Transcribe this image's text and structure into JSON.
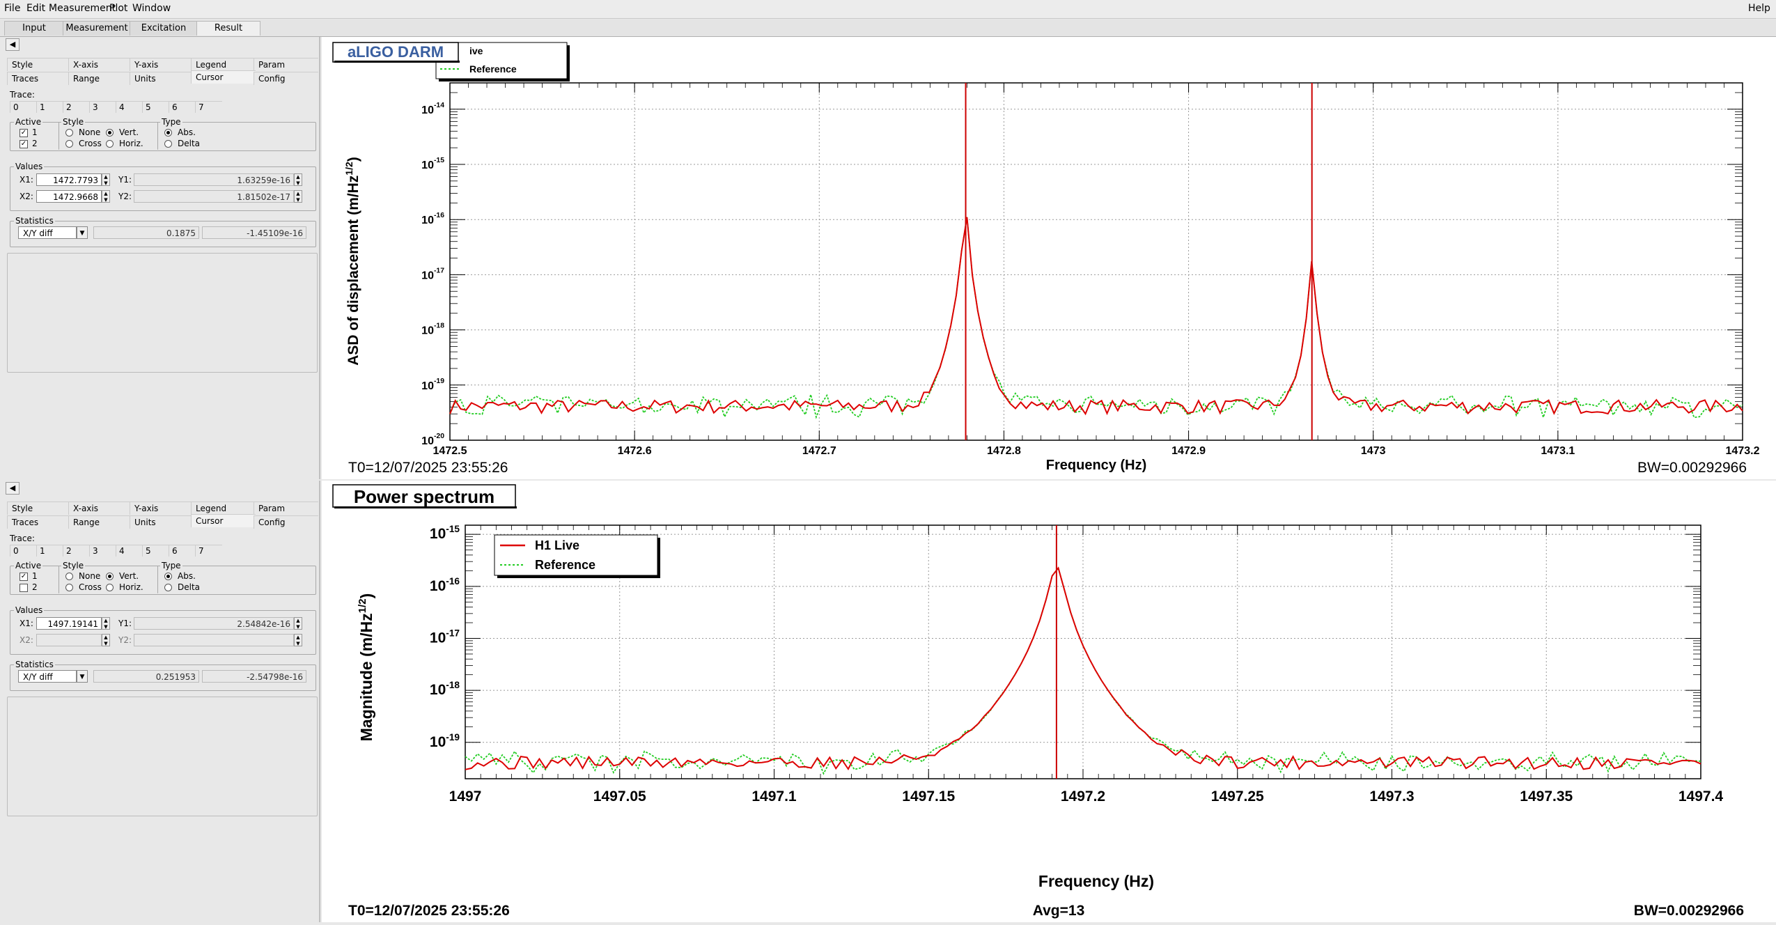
{
  "menu": [
    "File",
    "Edit",
    "Measurement",
    "Plot",
    "Window"
  ],
  "help": "Help",
  "tabs": [
    "Input",
    "Measurement",
    "Excitation",
    "Result"
  ],
  "side_tabs_row1": [
    "Style",
    "X-axis",
    "Y-axis",
    "Legend",
    "Param"
  ],
  "side_tabs_row2": [
    "Traces",
    "Range",
    "Units",
    "Cursor",
    "Config"
  ],
  "trace_label": "Trace:",
  "trace_tabs": [
    "0",
    "1",
    "2",
    "3",
    "4",
    "5",
    "6",
    "7"
  ],
  "active_label": "Active",
  "style_label": "Style",
  "type_label": "Type",
  "values_label": "Values",
  "statistics_label": "Statistics",
  "style_opts": [
    "None",
    "Vert.",
    "Cross",
    "Horiz."
  ],
  "type_opts": [
    "Abs.",
    "Delta"
  ],
  "panels": [
    {
      "active": [
        "1",
        "2"
      ],
      "active_checked": [
        true,
        true
      ],
      "x1_label": "X1:",
      "x2_label": "X2:",
      "y1_label": "Y1:",
      "y2_label": "Y2:",
      "x1": "1472.7793",
      "x2": "1472.9668",
      "y1": "1.63259e-16",
      "y2": "1.81502e-17",
      "stat_mode": "X/Y diff",
      "stat_x": "0.1875",
      "stat_y": "-1.45109e-16"
    },
    {
      "active": [
        "1",
        "2"
      ],
      "active_checked": [
        true,
        false
      ],
      "x1_label": "X1:",
      "x2_label": "X2:",
      "y1_label": "Y1:",
      "y2_label": "Y2:",
      "x1": "1497.19141",
      "x2": "",
      "y1": "2.54842e-16",
      "y2": "",
      "stat_mode": "X/Y diff",
      "stat_x": "0.251953",
      "stat_y": "-2.54798e-16"
    }
  ],
  "plot1": {
    "title": "aLIGO DARM",
    "legend": [
      "ive",
      "Reference"
    ],
    "ylabel": "ASD of displacement (m/Hz",
    "ylabel_sup": "1/2",
    "ylabel_end": ")",
    "xlabel": "Frequency (Hz)",
    "t0": "T0=12/07/2025 23:55:26",
    "bw": "BW=0.00292966",
    "xticks": [
      "1472.5",
      "1472.6",
      "1472.7",
      "1472.8",
      "1472.9",
      "1473",
      "1473.1",
      "1473.2"
    ],
    "yticks_exp": [
      "-14",
      "-15",
      "-16",
      "-17",
      "-18",
      "-19",
      "-20"
    ]
  },
  "plot2": {
    "title": "Power spectrum",
    "legend": [
      "H1 Live",
      "Reference"
    ],
    "ylabel": "Magnitude (m/Hz",
    "ylabel_sup": "1/2",
    "ylabel_end": ")",
    "xlabel": "Frequency (Hz)",
    "t0": "T0=12/07/2025 23:55:26",
    "avg": "Avg=13",
    "bw": "BW=0.00292966",
    "xticks": [
      "1497",
      "1497.05",
      "1497.1",
      "1497.15",
      "1497.2",
      "1497.25",
      "1497.3",
      "1497.35",
      "1497.4"
    ],
    "yticks_exp": [
      "-15",
      "-16",
      "-17",
      "-18",
      "-19"
    ]
  },
  "chart_data": [
    {
      "type": "line",
      "title": "aLIGO DARM",
      "xlabel": "Frequency (Hz)",
      "ylabel": "ASD of displacement (m/Hz^1/2)",
      "xlim": [
        1472.5,
        1473.2
      ],
      "ylim": [
        1e-20,
        3e-14
      ],
      "yscale": "log",
      "grid": true,
      "legend_position": "top-left",
      "series": [
        {
          "name": "ive",
          "color": "#dd0000",
          "style": "solid",
          "peaks": [
            [
              1472.7793,
              1.63e-16
            ],
            [
              1472.9668,
              1.8e-17
            ]
          ],
          "floor": 4e-20
        },
        {
          "name": "Reference",
          "color": "#22cc22",
          "style": "dotted",
          "peaks": [
            [
              1472.7793,
              1.63e-16
            ],
            [
              1472.9668,
              1.8e-17
            ]
          ],
          "floor": 4e-20
        }
      ],
      "cursors": [
        1472.7793,
        1472.9668
      ]
    },
    {
      "type": "line",
      "title": "Power spectrum",
      "xlabel": "Frequency (Hz)",
      "ylabel": "Magnitude (m/Hz^1/2)",
      "xlim": [
        1497,
        1497.4
      ],
      "ylim": [
        2e-20,
        1.5e-15
      ],
      "yscale": "log",
      "grid": true,
      "legend_position": "top-left",
      "series": [
        {
          "name": "H1 Live",
          "color": "#dd0000",
          "style": "solid",
          "peaks": [
            [
              1497.19141,
              2.55e-16
            ]
          ],
          "floor": 4e-20
        },
        {
          "name": "Reference",
          "color": "#22cc22",
          "style": "dotted",
          "peaks": [
            [
              1497.19141,
              2.55e-16
            ]
          ],
          "floor": 4e-20
        }
      ],
      "cursors": [
        1497.19141
      ]
    }
  ]
}
